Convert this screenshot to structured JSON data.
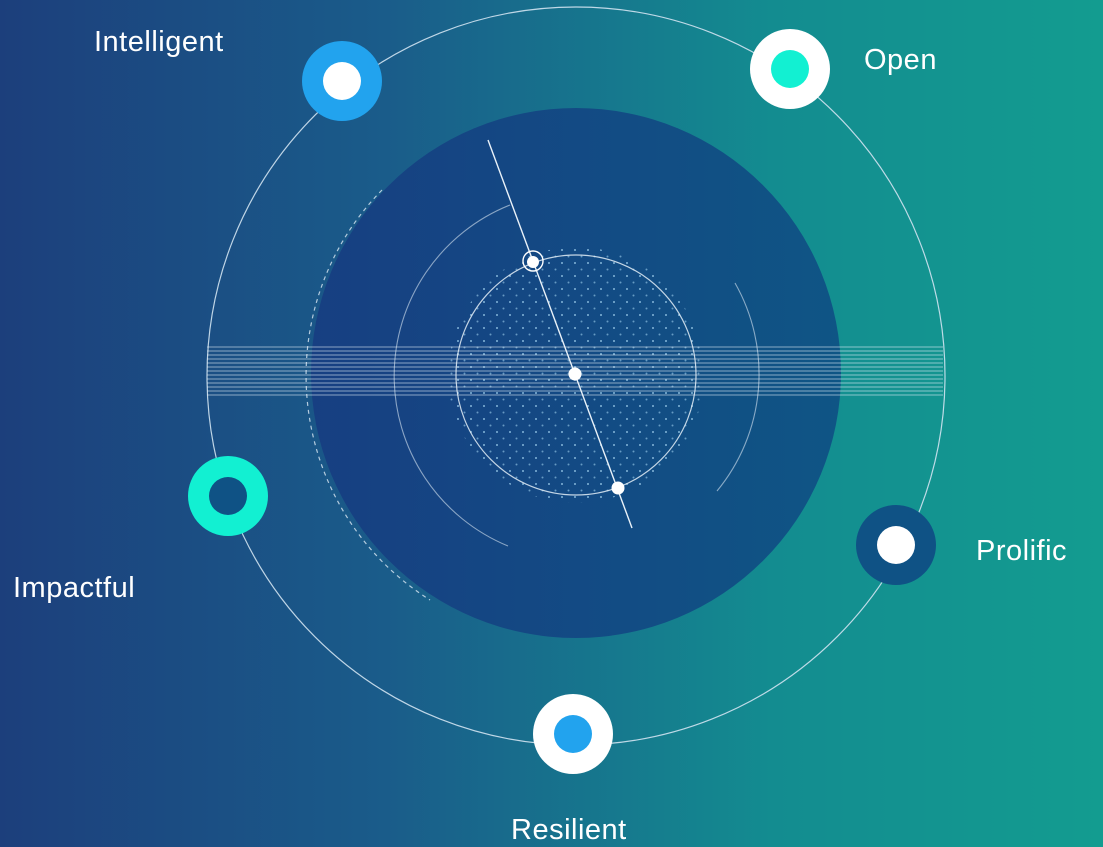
{
  "title": "",
  "nodes": [
    {
      "id": "intelligent",
      "label": "Intelligent",
      "ring_color": "#22a3ee",
      "center_color": "#ffffff"
    },
    {
      "id": "open",
      "label": "Open",
      "ring_color": "#ffffff",
      "center_color": "#12f0d2"
    },
    {
      "id": "impactful",
      "label": "Impactful",
      "ring_color": "#12f0d2",
      "center_color": "#0f5285"
    },
    {
      "id": "prolific",
      "label": "Prolific",
      "ring_color": "#0f5285",
      "center_color": "#ffffff"
    },
    {
      "id": "resilient",
      "label": "Resilient",
      "ring_color": "#ffffff",
      "center_color": "#22a3ee"
    }
  ],
  "colors": {
    "background_left": "#1c3f7c",
    "background_right": "#139c90",
    "core_circle": "#144d86",
    "orbit_line": "#c8dcef"
  }
}
